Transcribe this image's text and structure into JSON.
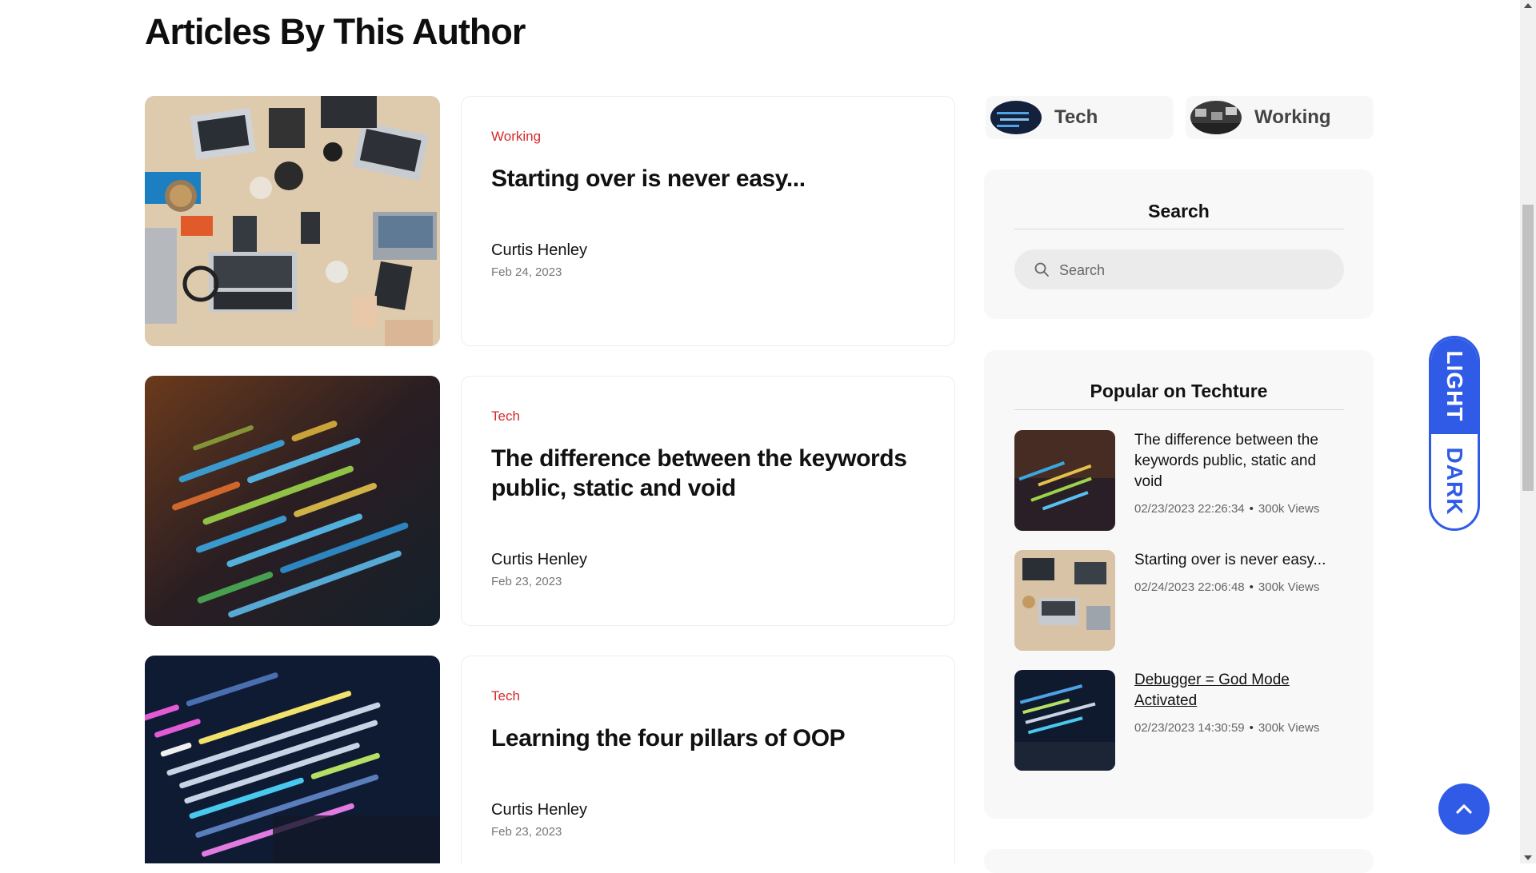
{
  "page": {
    "heading": "Articles By This Author"
  },
  "articles": [
    {
      "category": "Working",
      "title": "Starting over is never easy...",
      "author": "Curtis Henley",
      "date": "Feb 24, 2023",
      "image": "laptops-desk-photo"
    },
    {
      "category": "Tech",
      "title": "The difference between the keywords public, static and void",
      "author": "Curtis Henley",
      "date": "Feb 23, 2023",
      "image": "code-screen-photo"
    },
    {
      "category": "Tech",
      "title": "Learning the four pillars of OOP",
      "author": "Curtis Henley",
      "date": "Feb 23, 2023",
      "image": "code-laptop-photo"
    }
  ],
  "categories": [
    {
      "label": "Tech",
      "image": "code-thumb"
    },
    {
      "label": "Working",
      "image": "office-thumb"
    }
  ],
  "search": {
    "title": "Search",
    "placeholder": "Search"
  },
  "popular": {
    "title": "Popular on Techture",
    "items": [
      {
        "title": "The difference between the keywords public, static and void",
        "datetime": "02/23/2023 22:26:34",
        "views": "300k Views"
      },
      {
        "title": "Starting over is never easy...",
        "datetime": "02/24/2023 22:06:48",
        "views": "300k Views"
      },
      {
        "title": "Debugger = God Mode Activated",
        "datetime": "02/23/2023 14:30:59",
        "views": "300k Views"
      }
    ]
  },
  "theme_toggle": {
    "light": "LIGHT",
    "dark": "DARK"
  },
  "colors": {
    "accent": "#2f5be6",
    "category": "#d62a2a"
  }
}
